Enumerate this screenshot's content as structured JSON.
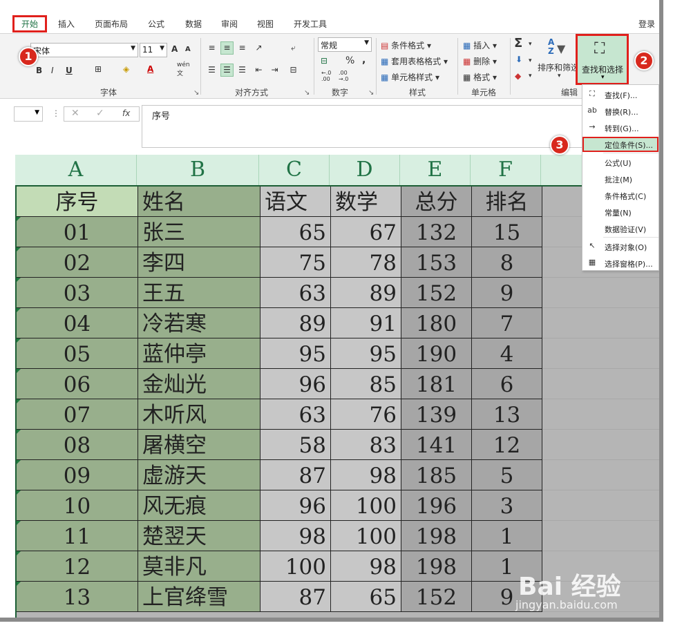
{
  "tabs": [
    {
      "label": "开始",
      "active": true
    },
    {
      "label": "插入"
    },
    {
      "label": "页面布局"
    },
    {
      "label": "公式"
    },
    {
      "label": "数据"
    },
    {
      "label": "审阅"
    },
    {
      "label": "视图"
    },
    {
      "label": "开发工具"
    }
  ],
  "login": "登录",
  "ribbon": {
    "font_name": "宋体",
    "font_size": "11",
    "number_format": "常规",
    "groups": {
      "font": "字体",
      "align": "对齐方式",
      "number": "数字",
      "styles": "样式",
      "cells": "单元格",
      "edit": "编辑"
    },
    "styles_items": [
      "条件格式",
      "套用表格格式",
      "单元格样式"
    ],
    "cells_items": [
      "插入",
      "删除",
      "格式"
    ],
    "sort_filter": "排序和筛选",
    "find_select": "查找和选择",
    "grow_font": "A",
    "shrink_font": "A",
    "bold": "B",
    "italic": "I",
    "underline": "U",
    "font_color_char": "A",
    "wen": "wén",
    "wen_char": "文",
    "percent": "%",
    "comma": ",",
    "dec_inc": "←.0\n.00",
    "dec_dec": ".00\n→.0",
    "sigma": "Σ",
    "sort_az": "A\nZ"
  },
  "formula_bar": {
    "fx": "fx",
    "content": "序号"
  },
  "menu": {
    "items": [
      {
        "icon": "binoculars-icon",
        "glyph": "⛶",
        "label": "查找(F)..."
      },
      {
        "icon": "replace-icon",
        "glyph": "ab",
        "label": "替换(R)..."
      },
      {
        "icon": "goto-arrow-icon",
        "glyph": "→",
        "label": "转到(G)..."
      },
      {
        "icon": "",
        "glyph": "",
        "label": "定位条件(S)...",
        "selected": true
      },
      {
        "icon": "",
        "glyph": "",
        "label": "公式(U)"
      },
      {
        "icon": "",
        "glyph": "",
        "label": "批注(M)"
      },
      {
        "icon": "",
        "glyph": "",
        "label": "条件格式(C)"
      },
      {
        "icon": "",
        "glyph": "",
        "label": "常量(N)"
      },
      {
        "icon": "",
        "glyph": "",
        "label": "数据验证(V)"
      },
      {
        "icon": "select-objects-icon",
        "glyph": "↖",
        "label": "选择对象(O)"
      },
      {
        "icon": "selection-pane-icon",
        "glyph": "▦",
        "label": "选择窗格(P)..."
      }
    ]
  },
  "badges": [
    "1",
    "2",
    "3"
  ],
  "sheet": {
    "columns": [
      "A",
      "B",
      "C",
      "D",
      "E",
      "F"
    ],
    "header": [
      "序号",
      "姓名",
      "语文",
      "数学",
      "总分",
      "排名"
    ],
    "rows": [
      [
        "01",
        "张三",
        "65",
        "67",
        "132",
        "15"
      ],
      [
        "02",
        "李四",
        "75",
        "78",
        "153",
        "8"
      ],
      [
        "03",
        "王五",
        "63",
        "89",
        "152",
        "9"
      ],
      [
        "04",
        "冷若寒",
        "89",
        "91",
        "180",
        "7"
      ],
      [
        "05",
        "蓝仲亭",
        "95",
        "95",
        "190",
        "4"
      ],
      [
        "06",
        "金灿光",
        "96",
        "85",
        "181",
        "6"
      ],
      [
        "07",
        "木听风",
        "63",
        "76",
        "139",
        "13"
      ],
      [
        "08",
        "屠横空",
        "58",
        "83",
        "141",
        "12"
      ],
      [
        "09",
        "虚游天",
        "87",
        "98",
        "185",
        "5"
      ],
      [
        "10",
        "风无痕",
        "96",
        "100",
        "196",
        "3"
      ],
      [
        "11",
        "楚翌天",
        "98",
        "100",
        "198",
        "1"
      ],
      [
        "12",
        "莫非凡",
        "100",
        "98",
        "198",
        "1"
      ],
      [
        "13",
        "上官绛雪",
        "87",
        "65",
        "152",
        "9"
      ]
    ]
  },
  "watermark": {
    "logo": "Bai 经验",
    "url": "jingyan.baidu.com"
  },
  "colors": {
    "excel_green": "#217346",
    "highlight_red": "#e0201c",
    "selected_fill": "#c6e6d0"
  }
}
